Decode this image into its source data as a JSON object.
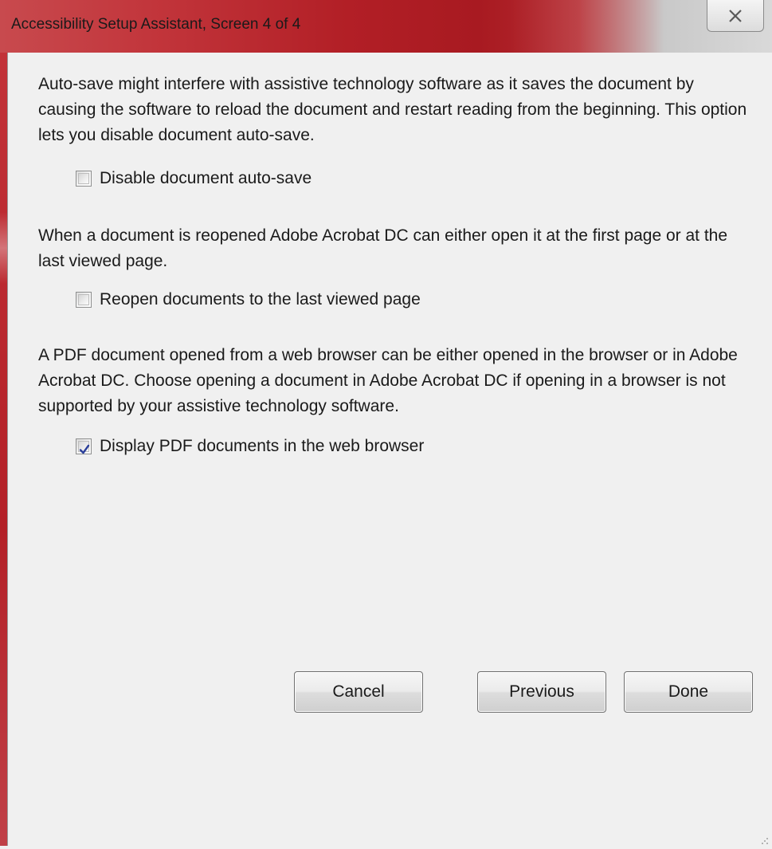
{
  "window": {
    "title": "Accessibility Setup Assistant, Screen 4 of 4"
  },
  "sections": [
    {
      "description": "Auto-save might interfere with assistive technology software as it saves the document by causing the software to reload the document and restart reading from the beginning. This option lets you disable document auto-save.",
      "option_label": "Disable document auto-save",
      "checked": false
    },
    {
      "description": "When a document is reopened Adobe Acrobat DC can either open it at the first page or at the last viewed page.",
      "option_label": "Reopen documents to the last viewed page",
      "checked": false
    },
    {
      "description": "A PDF document opened from a web browser can be either opened in the browser or in Adobe Acrobat DC. Choose opening a document in Adobe Acrobat DC if opening in a browser is not supported by your assistive technology software.",
      "option_label": "Display PDF documents in the web browser",
      "checked": true
    }
  ],
  "buttons": {
    "cancel": "Cancel",
    "previous": "Previous",
    "done": "Done"
  },
  "icons": {
    "close": "close-icon",
    "check": "checkmark-icon"
  },
  "colors": {
    "title_bar": "#b21f26",
    "background": "#f0f0f0",
    "check": "#2b3f9a"
  }
}
